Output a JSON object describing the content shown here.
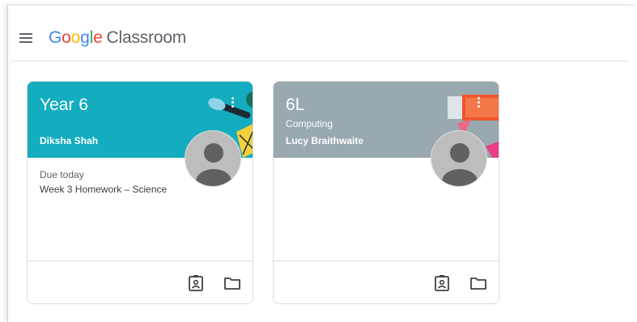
{
  "app": {
    "logo_letters": [
      "G",
      "o",
      "o",
      "g",
      "l",
      "e"
    ],
    "product": "Classroom"
  },
  "icons": {
    "menu": "hamburger-menu-icon",
    "more": "more-vert-icon",
    "avatar": "person-avatar-icon",
    "work": "assignment-ind-icon",
    "folder": "folder-icon"
  },
  "colors": {
    "card1_banner": "#14acbf",
    "card2_banner": "#9aa9b0"
  },
  "classes": [
    {
      "title": "Year 6",
      "section": "",
      "teacher": "Diksha Shah",
      "due_label": "Due today",
      "due_item": "Week 3 Homework – Science"
    },
    {
      "title": "6L",
      "section": "Computing",
      "teacher": "Lucy Braithwaite",
      "due_label": "",
      "due_item": ""
    }
  ]
}
